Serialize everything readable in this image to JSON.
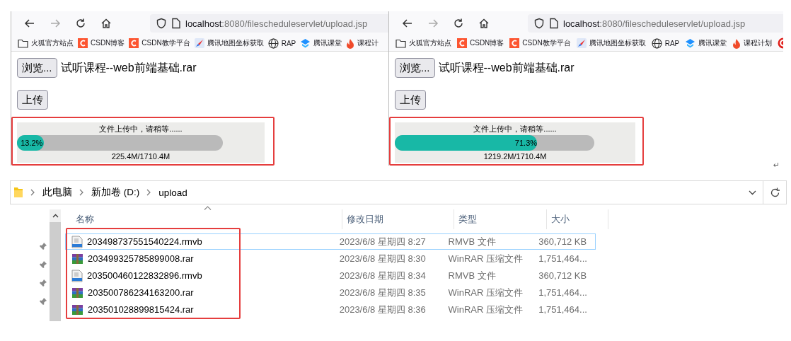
{
  "browsers": [
    {
      "url_host": "localhost",
      "url_rest": ":8080/filescheduleservlet/upload.jsp",
      "bookmarks": [
        {
          "kind": "folder",
          "label": "火狐官方站点"
        },
        {
          "kind": "csdn",
          "label": "CSDN博客"
        },
        {
          "kind": "csdn",
          "label": "CSDN教学平台"
        },
        {
          "kind": "map",
          "label": "腾讯地图坐标获取"
        },
        {
          "kind": "globe",
          "label": "RAP"
        },
        {
          "kind": "ketang",
          "label": "腾讯课堂"
        },
        {
          "kind": "fire",
          "label": "课程计"
        }
      ],
      "browse_button": "浏览...",
      "file_name": "试听课程--web前端基础.rar",
      "upload_button": "上传",
      "progress": {
        "status": "文件上传中，请稍等......",
        "level": 0.132,
        "percent": "13.2%",
        "transferred": "225.4M/1710.4M"
      }
    },
    {
      "url_host": "localhost",
      "url_rest": ":8080/filescheduleservlet/upload.jsp",
      "bookmarks": [
        {
          "kind": "folder",
          "label": "火狐官方站点"
        },
        {
          "kind": "csdn",
          "label": "CSDN博客"
        },
        {
          "kind": "csdn",
          "label": "CSDN教学平台"
        },
        {
          "kind": "map",
          "label": "腾讯地图坐标获取"
        },
        {
          "kind": "globe",
          "label": "RAP"
        },
        {
          "kind": "ketang",
          "label": "腾讯课堂"
        },
        {
          "kind": "fire",
          "label": "课程计划"
        },
        {
          "kind": "g"
        }
      ],
      "browse_button": "浏览...",
      "file_name": "试听课程--web前端基础.rar",
      "upload_button": "上传",
      "progress": {
        "status": "文件上传中，请稍等......",
        "level": 0.713,
        "percent": "71.3%",
        "transferred": "1219.2M/1710.4M"
      }
    }
  ],
  "return_mark": "↵",
  "explorer": {
    "breadcrumb": [
      "此电脑",
      "新加卷 (D:)",
      "upload"
    ],
    "columns": [
      "名称",
      "修改日期",
      "类型",
      "大小"
    ],
    "rows": [
      {
        "kind": "video",
        "name": "203498737551540224.rmvb",
        "modified": "2023/6/8 星期四 8:27",
        "type": "RMVB 文件",
        "size": "360,712 KB",
        "selected": true
      },
      {
        "kind": "archive",
        "name": "203499325785899008.rar",
        "modified": "2023/6/8 星期四 8:30",
        "type": "WinRAR 压缩文件",
        "size": "1,751,464...",
        "selected": false
      },
      {
        "kind": "video",
        "name": "203500460122832896.rmvb",
        "modified": "2023/6/8 星期四 8:34",
        "type": "RMVB 文件",
        "size": "360,712 KB",
        "selected": false
      },
      {
        "kind": "archive",
        "name": "203500786234163200.rar",
        "modified": "2023/6/8 星期四 8:35",
        "type": "WinRAR 压缩文件",
        "size": "1,751,464...",
        "selected": false
      },
      {
        "kind": "archive",
        "name": "203501028899815424.rar",
        "modified": "2023/6/8 星期四 8:36",
        "type": "WinRAR 压缩文件",
        "size": "1,751,464...",
        "selected": false
      }
    ]
  }
}
